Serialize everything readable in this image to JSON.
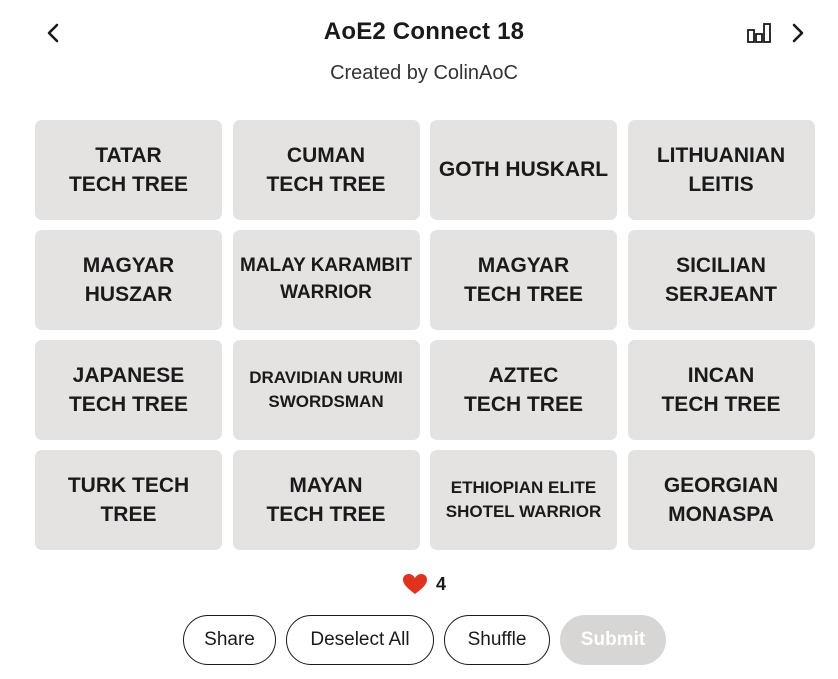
{
  "header": {
    "title": "AoE2 Connect 18",
    "subtitle": "Created by ColinAoC",
    "prev_icon": "chevron-left-icon",
    "next_icon": "chevron-right-icon",
    "stats_icon": "bar-chart-icon"
  },
  "tiles": [
    {
      "line1": "TATAR",
      "line2": "TECH TREE"
    },
    {
      "line1": "CUMAN",
      "line2": "TECH TREE"
    },
    {
      "line1": "GOTH HUSKARL",
      "line2": ""
    },
    {
      "line1": "LITHUANIAN",
      "line2": "LEITIS"
    },
    {
      "line1": "MAGYAR",
      "line2": "HUSZAR"
    },
    {
      "line1": "MALAY KARAMBIT",
      "line2": "WARRIOR"
    },
    {
      "line1": "MAGYAR",
      "line2": "TECH TREE"
    },
    {
      "line1": "SICILIAN",
      "line2": "SERJEANT"
    },
    {
      "line1": "JAPANESE",
      "line2": "TECH TREE"
    },
    {
      "line1": "DRAVIDIAN URUMI",
      "line2": "SWORDSMAN"
    },
    {
      "line1": "AZTEC",
      "line2": "TECH TREE"
    },
    {
      "line1": "INCAN",
      "line2": "TECH TREE"
    },
    {
      "line1": "TURK TECH",
      "line2": "TREE"
    },
    {
      "line1": "MAYAN",
      "line2": "TECH TREE"
    },
    {
      "line1": "ETHIOPIAN ELITE",
      "line2": "SHOTEL WARRIOR"
    },
    {
      "line1": "GEORGIAN",
      "line2": "MONASPA"
    }
  ],
  "lives": {
    "icon": "heart-icon",
    "count": "4",
    "color": "#e0321f"
  },
  "actions": {
    "share": "Share",
    "deselect_all": "Deselect All",
    "shuffle": "Shuffle",
    "submit": "Submit"
  },
  "colors": {
    "tile_bg": "#e5e3e1",
    "submit_disabled": "#d7d6d5"
  }
}
